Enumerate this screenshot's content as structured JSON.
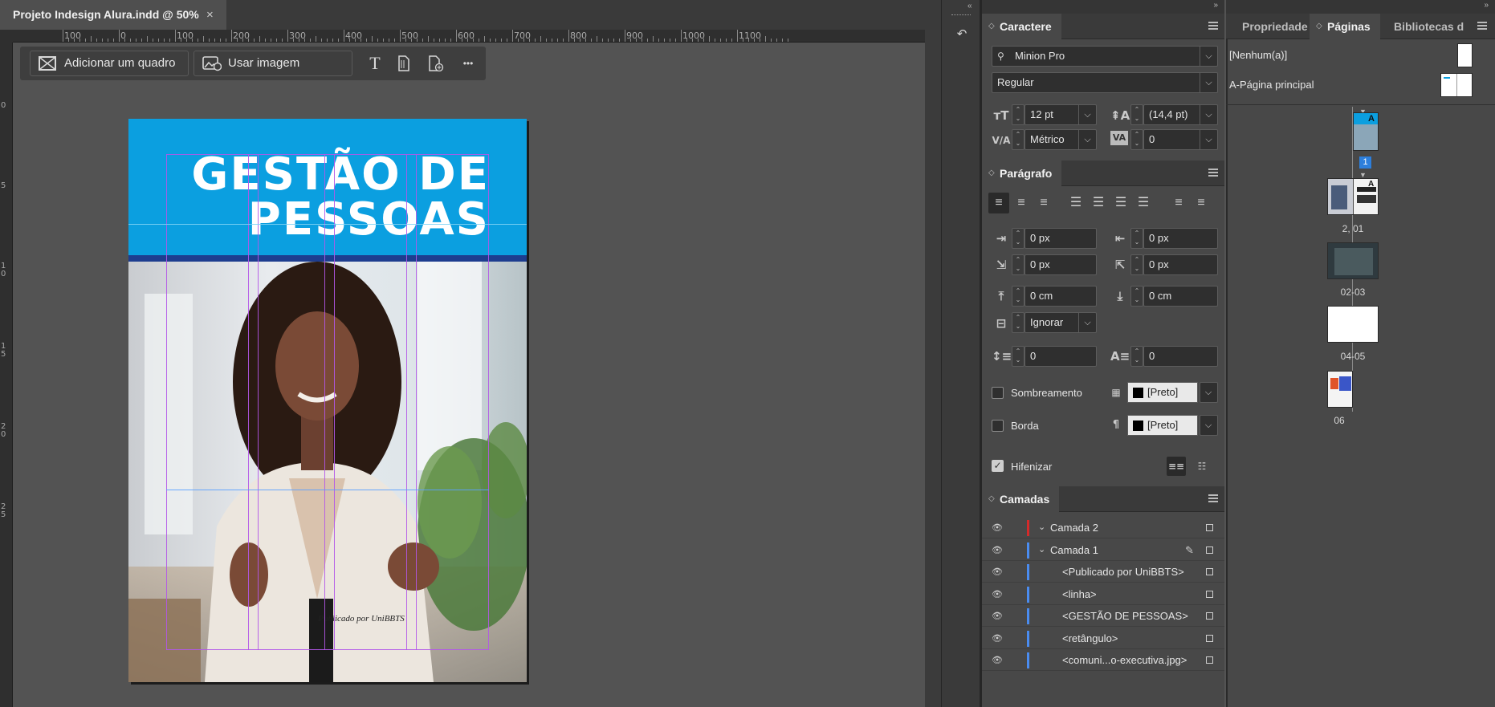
{
  "document": {
    "tab_title": "Projeto Indesign Alura.indd @ 50%",
    "close_glyph": "×"
  },
  "ruler": {
    "top_labels": [
      "100",
      "0",
      "100",
      "200",
      "300",
      "400",
      "500",
      "600",
      "700",
      "800",
      "900",
      "1000",
      "1100"
    ],
    "left_labels": [
      "0",
      "5",
      "1 0",
      "1 5",
      "2 0",
      "2 5"
    ]
  },
  "taskbar": {
    "add_frame": "Adicionar um quadro",
    "use_image": "Usar imagem",
    "more": "•••"
  },
  "page": {
    "title_line1": "GESTÃO DE",
    "title_line2": "PESSOAS",
    "credit": "Publicado por UniBBTS"
  },
  "character_panel": {
    "title": "Caractere",
    "font_family": "Minion Pro",
    "font_style": "Regular",
    "font_size": "12 pt",
    "leading": "(14,4 pt)",
    "kerning": "Métrico",
    "tracking": "0"
  },
  "paragraph_panel": {
    "title": "Parágrafo",
    "left_indent": "0 px",
    "right_indent": "0 px",
    "first_line_indent": "0 px",
    "last_line_indent": "0 px",
    "space_before": "0 cm",
    "space_after": "0 cm",
    "align_to_grid": "Ignorar",
    "drop_cap_lines": "0",
    "drop_cap_chars": "0",
    "shading_label": "Sombreamento",
    "shading_color": "[Preto]",
    "border_label": "Borda",
    "border_color": "[Preto]",
    "hyphenate_label": "Hifenizar",
    "hyphenate_checked": true
  },
  "layers_panel": {
    "title": "Camadas",
    "rows": [
      {
        "name": "Camada 2",
        "color": "#d42a2a",
        "level": 0
      },
      {
        "name": "Camada 1",
        "color": "#4a8cf0",
        "level": 0
      },
      {
        "name": "<Publicado por UniBBTS>",
        "color": "#4a8cf0",
        "level": 1
      },
      {
        "name": "<linha>",
        "color": "#4a8cf0",
        "level": 1
      },
      {
        "name": "<GESTÃO DE PESSOAS>",
        "color": "#4a8cf0",
        "level": 1
      },
      {
        "name": "<retângulo>",
        "color": "#4a8cf0",
        "level": 1
      },
      {
        "name": "<comuni...o-executiva.jpg>",
        "color": "#4a8cf0",
        "level": 1
      }
    ]
  },
  "right_panel": {
    "tabs": [
      "Propriedade",
      "Páginas",
      "Bibliotecas d"
    ],
    "active_tab": "Páginas",
    "master_none": "[Nenhum(a)]",
    "master_a": "A-Página principal",
    "page_labels": [
      "1",
      "2, 01",
      "02-03",
      "04-05",
      "06"
    ]
  },
  "colors": {
    "accent_blue": "#0b9fe0",
    "stripe_navy": "#1d3d8f",
    "guide": "#b356e8",
    "page_badge": "#2d7fdc"
  }
}
